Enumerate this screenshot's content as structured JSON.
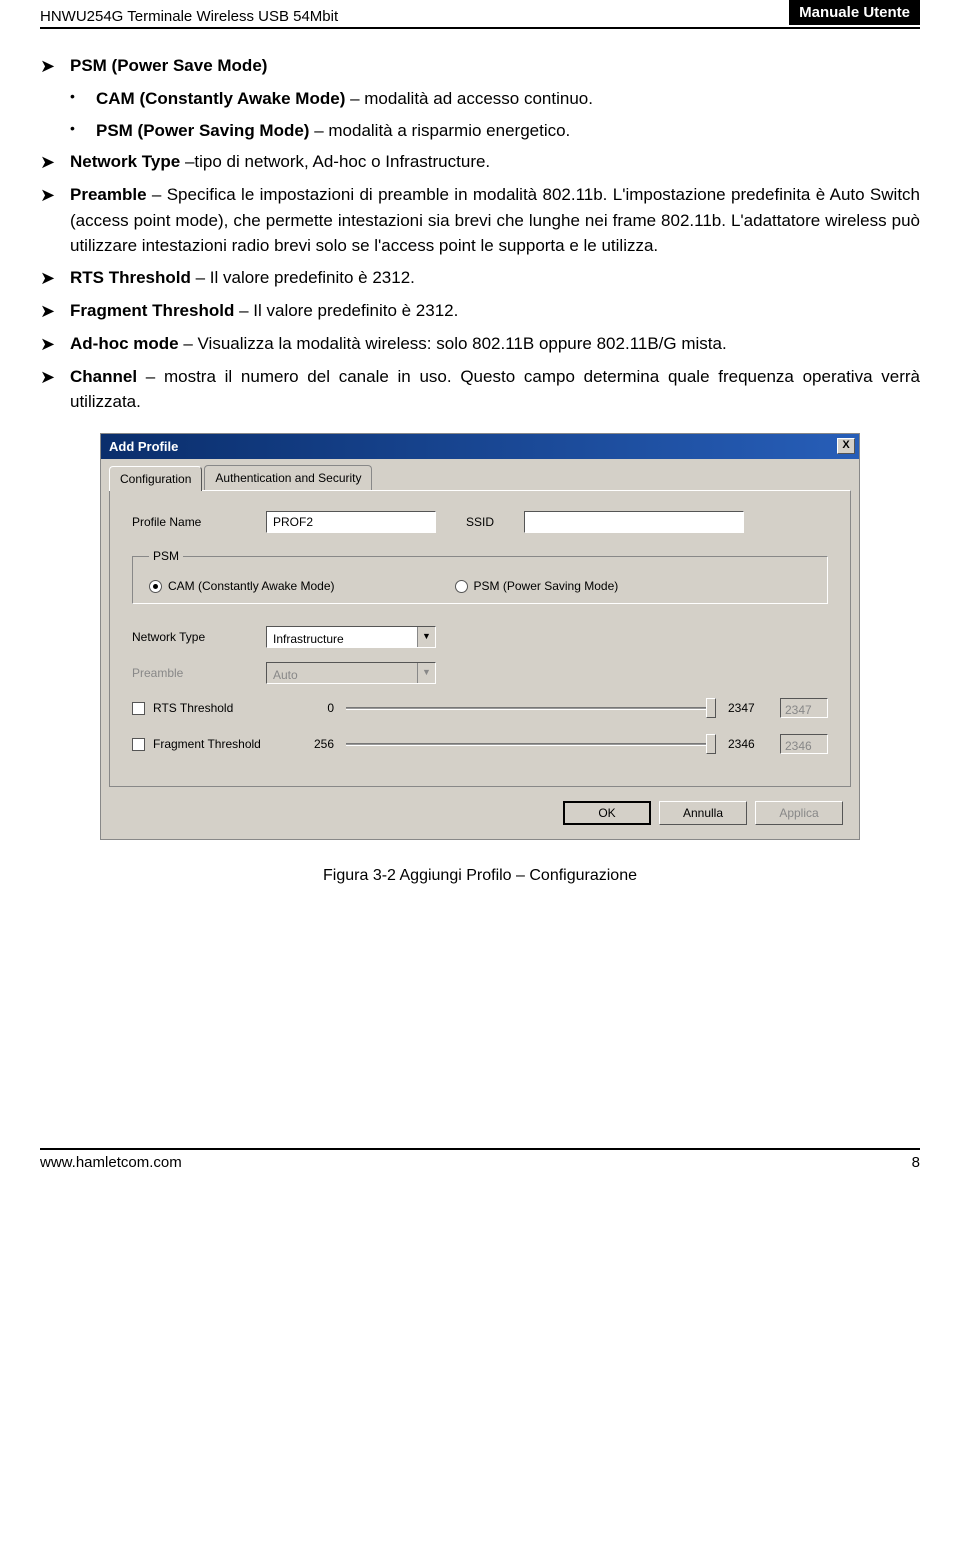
{
  "header": {
    "product": "HNWU254G Terminale Wireless USB 54Mbit",
    "doc_title": "Manuale Utente"
  },
  "bullets": {
    "psm_title_bold": "PSM (Power Save Mode)",
    "cam_bold": "CAM (Constantly Awake Mode)",
    "cam_rest": " – modalità ad accesso continuo.",
    "psm2_bold": "PSM (Power Saving Mode)",
    "psm2_rest": " – modalità a risparmio energetico.",
    "nt_bold": "Network Type",
    "nt_rest": " –tipo di network, Ad-hoc o Infrastructure.",
    "pre_bold": "Preamble",
    "pre_rest": " – Specifica le impostazioni di preamble in modalità 802.11b. L'impostazione predefinita è Auto Switch (access point mode), che permette intestazioni sia brevi che lunghe nei frame 802.11b. L'adattatore wireless può utilizzare intestazioni radio brevi solo se l'access point le supporta e le utilizza.",
    "rts_bold": "RTS Threshold",
    "rts_rest": " – Il valore predefinito è 2312.",
    "frag_bold": "Fragment Threshold",
    "frag_rest": " – Il valore predefinito è 2312.",
    "adhoc_bold": "Ad-hoc mode",
    "adhoc_rest": " – Visualizza la modalità wireless: solo 802.11B oppure 802.11B/G mista.",
    "chan_bold": "Channel",
    "chan_rest": " – mostra il numero del canale in uso. Questo campo determina quale frequenza operativa verrà utilizzata."
  },
  "dialog": {
    "title": "Add Profile",
    "close": "X",
    "tab1": "Configuration",
    "tab2": "Authentication and Security",
    "profile_name_lbl": "Profile Name",
    "profile_name_val": "PROF2",
    "ssid_lbl": "SSID",
    "ssid_val": "",
    "psm_legend": "PSM",
    "radio_cam": "CAM (Constantly Awake Mode)",
    "radio_psm": "PSM (Power Saving Mode)",
    "network_type_lbl": "Network Type",
    "network_type_val": "Infrastructure",
    "preamble_lbl": "Preamble",
    "preamble_val": "Auto",
    "rts_lbl": "RTS Threshold",
    "rts_min": "0",
    "rts_max": "2347",
    "rts_val": "2347",
    "frag_lbl": "Fragment Threshold",
    "frag_min": "256",
    "frag_max": "2346",
    "frag_val": "2346",
    "ok": "OK",
    "cancel": "Annulla",
    "apply": "Applica"
  },
  "caption": "Figura 3-2 Aggiungi Profilo – Configurazione",
  "footer": {
    "url": "www.hamletcom.com",
    "page": "8"
  }
}
